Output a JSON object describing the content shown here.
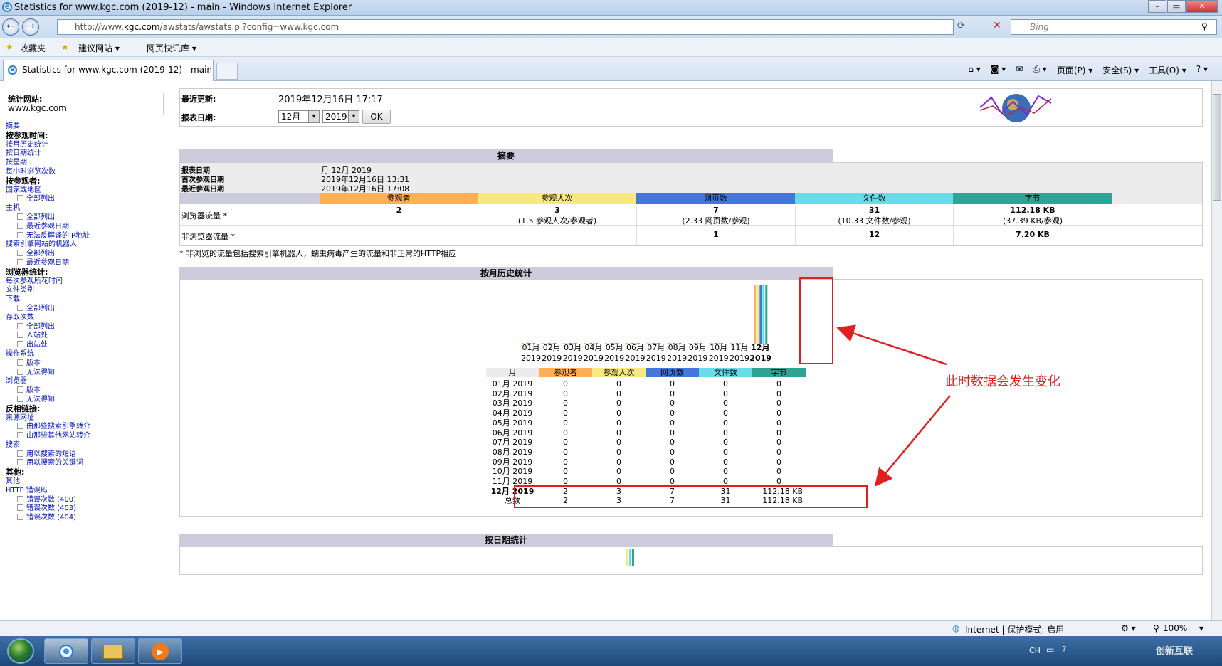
{
  "window": {
    "title": "Statistics for www.kgc.com (2019-12) - main - Windows Internet Explorer",
    "url_prefix": "http://www.",
    "url_domain": "kgc.com",
    "url_path": "/awstats/awstats.pl?config=www.kgc.com",
    "search_placeholder": "Bing",
    "favorites": "收藏夹",
    "suggested_sites": "建议网站 ▾",
    "web_slice": "网页快讯库 ▾",
    "tab_title": "Statistics for www.kgc.com (2019-12) - main",
    "cmd_page": "页面(P) ▾",
    "cmd_safety": "安全(S) ▾",
    "cmd_tools": "工具(O) ▾"
  },
  "menu": {
    "site_label": "统计网站:",
    "site_value": "www.kgc.com",
    "items": [
      {
        "text": "摘要",
        "type": "link"
      },
      {
        "text": "按参观时间:",
        "type": "h"
      },
      {
        "text": "按月历史统计",
        "type": "link"
      },
      {
        "text": "按日期统计",
        "type": "link"
      },
      {
        "text": "按星期",
        "type": "link"
      },
      {
        "text": "每小时浏览次数",
        "type": "link"
      },
      {
        "text": "按参观者:",
        "type": "h"
      },
      {
        "text": "国家或地区",
        "type": "link"
      },
      {
        "text": "全部列出",
        "type": "sub"
      },
      {
        "text": "主机",
        "type": "link"
      },
      {
        "text": "全部列出",
        "type": "sub"
      },
      {
        "text": "最近参观日期",
        "type": "sub"
      },
      {
        "text": "无法反解译的IP地址",
        "type": "sub"
      },
      {
        "text": "搜索引擎网站的机器人",
        "type": "link"
      },
      {
        "text": "全部列出",
        "type": "sub"
      },
      {
        "text": "最近参观日期",
        "type": "sub"
      },
      {
        "text": "浏览器统计:",
        "type": "h"
      },
      {
        "text": "每次参观所花时间",
        "type": "link"
      },
      {
        "text": "文件类别",
        "type": "link"
      },
      {
        "text": "下载",
        "type": "link"
      },
      {
        "text": "全部列出",
        "type": "sub"
      },
      {
        "text": "存取次数",
        "type": "link"
      },
      {
        "text": "全部列出",
        "type": "sub"
      },
      {
        "text": "入站处",
        "type": "sub"
      },
      {
        "text": "出站处",
        "type": "sub"
      },
      {
        "text": "操作系统",
        "type": "link"
      },
      {
        "text": "版本",
        "type": "sub"
      },
      {
        "text": "无法得知",
        "type": "sub"
      },
      {
        "text": "浏览器",
        "type": "link"
      },
      {
        "text": "版本",
        "type": "sub"
      },
      {
        "text": "无法得知",
        "type": "sub"
      },
      {
        "text": "反相链接:",
        "type": "h"
      },
      {
        "text": "来源网址",
        "type": "link"
      },
      {
        "text": "由那些搜索引擎转介",
        "type": "sub"
      },
      {
        "text": "由那些其他网站转介",
        "type": "sub"
      },
      {
        "text": "搜索",
        "type": "link"
      },
      {
        "text": "用以搜索的短语",
        "type": "sub"
      },
      {
        "text": "用以搜索的关键词",
        "type": "sub"
      },
      {
        "text": "其他:",
        "type": "h"
      },
      {
        "text": "其他",
        "type": "link"
      },
      {
        "text": "HTTP 错误码",
        "type": "link"
      },
      {
        "text": "错误次数 (400)",
        "type": "sub"
      },
      {
        "text": "错误次数 (403)",
        "type": "sub"
      },
      {
        "text": "错误次数 (404)",
        "type": "sub"
      }
    ]
  },
  "header": {
    "last_update_label": "最近更新:",
    "last_update_value": "2019年12月16日 17:17",
    "report_date_label": "报表日期:",
    "month_select": "12月",
    "year_select": "2019",
    "ok": "OK"
  },
  "summary": {
    "title": "摘要",
    "report_date_label": "报表日期",
    "report_date_value": "月 12月 2019",
    "first_visit_label": "首次参观日期",
    "first_visit_value": "2019年12月16日 13:31",
    "last_visit_label": "最近参观日期",
    "last_visit_value": "2019年12月16日 17:08",
    "columns": [
      "参观者",
      "参观人次",
      "网页数",
      "文件数",
      "字节"
    ],
    "col_colors": [
      "#ffb055",
      "#f8e880",
      "#4477dd",
      "#66dde8",
      "#2ea495"
    ],
    "row1_label": "浏览器流量 *",
    "row1": [
      [
        "2",
        ""
      ],
      [
        "3",
        "(1.5 参观人次/参观者)"
      ],
      [
        "7",
        "(2.33 网页数/参观)"
      ],
      [
        "31",
        "(10.33 文件数/参观)"
      ],
      [
        "112.18 KB",
        "(37.39 KB/参观)"
      ]
    ],
    "row2_label": "非浏览器流量 *",
    "row2": [
      "",
      "",
      "1",
      "12",
      "7.20 KB"
    ],
    "footnote": "* 非浏览的流量包括搜索引擎机器人，蠕虫病毒产生的流量和非正常的HTTP相应"
  },
  "monthly": {
    "title": "按月历史统计",
    "months": [
      "01月",
      "02月",
      "03月",
      "04月",
      "05月",
      "06月",
      "07月",
      "08月",
      "09月",
      "10月",
      "11月",
      "12月"
    ],
    "year": "2019",
    "table_headers": [
      "月",
      "参观者",
      "参观人次",
      "网页数",
      "文件数",
      "字节"
    ],
    "rows": [
      [
        "01月 2019",
        "0",
        "0",
        "0",
        "0",
        "0"
      ],
      [
        "02月 2019",
        "0",
        "0",
        "0",
        "0",
        "0"
      ],
      [
        "03月 2019",
        "0",
        "0",
        "0",
        "0",
        "0"
      ],
      [
        "04月 2019",
        "0",
        "0",
        "0",
        "0",
        "0"
      ],
      [
        "05月 2019",
        "0",
        "0",
        "0",
        "0",
        "0"
      ],
      [
        "06月 2019",
        "0",
        "0",
        "0",
        "0",
        "0"
      ],
      [
        "07月 2019",
        "0",
        "0",
        "0",
        "0",
        "0"
      ],
      [
        "08月 2019",
        "0",
        "0",
        "0",
        "0",
        "0"
      ],
      [
        "09月 2019",
        "0",
        "0",
        "0",
        "0",
        "0"
      ],
      [
        "10月 2019",
        "0",
        "0",
        "0",
        "0",
        "0"
      ],
      [
        "11月 2019",
        "0",
        "0",
        "0",
        "0",
        "0"
      ],
      [
        "12月 2019",
        "2",
        "3",
        "7",
        "31",
        "112.18 KB"
      ],
      [
        "总数",
        "2",
        "3",
        "7",
        "31",
        "112.18 KB"
      ]
    ]
  },
  "chart_data": {
    "type": "bar",
    "categories": [
      "01月 2019",
      "02月 2019",
      "03月 2019",
      "04月 2019",
      "05月 2019",
      "06月 2019",
      "07月 2019",
      "08月 2019",
      "09月 2019",
      "10月 2019",
      "11月 2019",
      "12月 2019"
    ],
    "series": [
      {
        "name": "参观者",
        "color": "#ffb055",
        "values": [
          0,
          0,
          0,
          0,
          0,
          0,
          0,
          0,
          0,
          0,
          0,
          2
        ]
      },
      {
        "name": "参观人次",
        "color": "#f8e880",
        "values": [
          0,
          0,
          0,
          0,
          0,
          0,
          0,
          0,
          0,
          0,
          0,
          3
        ]
      },
      {
        "name": "网页数",
        "color": "#4477dd",
        "values": [
          0,
          0,
          0,
          0,
          0,
          0,
          0,
          0,
          0,
          0,
          0,
          7
        ]
      },
      {
        "name": "文件数",
        "color": "#66dde8",
        "values": [
          0,
          0,
          0,
          0,
          0,
          0,
          0,
          0,
          0,
          0,
          0,
          31
        ]
      },
      {
        "name": "字节",
        "color": "#2ea495",
        "values": [
          0,
          0,
          0,
          0,
          0,
          0,
          0,
          0,
          0,
          0,
          0,
          112.18
        ]
      }
    ]
  },
  "daily": {
    "title": "按日期统计"
  },
  "annotation": "此时数据会发生变化",
  "status": {
    "zone": "Internet | 保护模式: 启用",
    "zoom": "100%"
  },
  "taskbar": {
    "lang": "CH",
    "watermark": "创新互联"
  }
}
